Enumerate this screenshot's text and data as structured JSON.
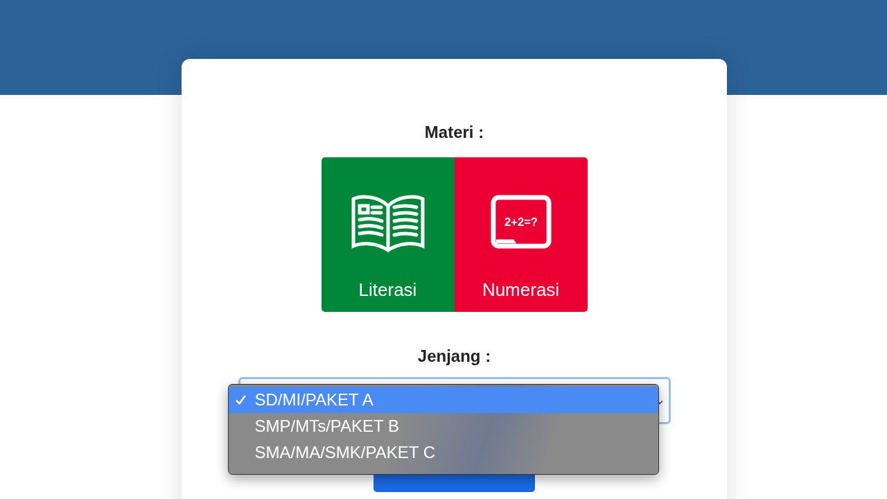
{
  "materi": {
    "label": "Materi :",
    "tiles": [
      {
        "label": "Literasi",
        "kind": "book",
        "color": "#00873a"
      },
      {
        "label": "Numerasi",
        "kind": "board",
        "color": "#ec0033",
        "board_text": "2+2=?"
      }
    ]
  },
  "jenjang": {
    "label": "Jenjang :",
    "options": [
      {
        "label": "SD/MI/PAKET A",
        "selected": true
      },
      {
        "label": "SMP/MTs/PAKET B",
        "selected": false
      },
      {
        "label": "SMA/MA/SMK/PAKET C",
        "selected": false
      }
    ]
  }
}
